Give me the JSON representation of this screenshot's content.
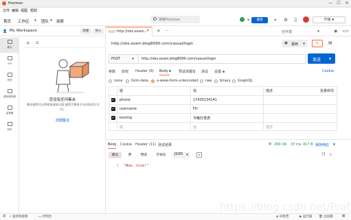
{
  "window": {
    "title": "Postman",
    "minimize": "—",
    "maximize": "☐",
    "close": "✕"
  },
  "menu": [
    "文件",
    "编辑",
    "视图",
    "帮助"
  ],
  "header": {
    "nav": [
      "首页",
      "工作区",
      "团队",
      "探索"
    ],
    "search_placeholder": "搜索Postman",
    "invite_label": "邀请",
    "upgrade_label": "升级"
  },
  "sidebar": {
    "workspace": "My Workspace",
    "new_label": "新建",
    "import_label": "导入",
    "rail": [
      {
        "label": "集合",
        "icon": "collections-icon"
      },
      {
        "label": "API",
        "icon": "api-icon"
      },
      {
        "label": "环境",
        "icon": "environments-icon"
      },
      {
        "label": "模拟服务器",
        "icon": "mock-servers-icon"
      },
      {
        "label": "监视器",
        "icon": "monitors-icon"
      },
      {
        "label": "历史",
        "icon": "history-icon"
      }
    ],
    "empty_title": "您没有任何集合",
    "empty_desc": "集合使您可以将相关请求分组,使您可更易于访问和运行它们。",
    "create_link": "创建集合"
  },
  "tabs": {
    "active_method": "POST",
    "active_url": "http://obs.exam...",
    "environment": "无环境"
  },
  "request": {
    "title": "http://obs.exam.blog8090.com/casual/login",
    "save_label": "保存",
    "method": "POST",
    "url": "http://obs.exam.blog8090.com/casual/login",
    "send_label": "发送",
    "tabs": [
      {
        "label": "参数"
      },
      {
        "label": "授权"
      },
      {
        "label": "Header (8)"
      },
      {
        "label": "Body"
      },
      {
        "label": "预请求脚本"
      },
      {
        "label": "测试"
      },
      {
        "label": "设置"
      }
    ],
    "cookies_label": "Cookie",
    "body_types": [
      "none",
      "form-data",
      "x-www-form-urlencoded",
      "raw",
      "binary",
      "GraphQL"
    ],
    "selected_body_type": "x-www-form-urlencoded",
    "table": {
      "headers": {
        "key": "键",
        "value": "值",
        "desc": "描述",
        "bulk": "批量修改"
      },
      "rows": [
        {
          "key": "phone",
          "value": "17435134141"
        },
        {
          "key": "username",
          "value": "FD"
        },
        {
          "key": "kouling",
          "value": "今晚打老虎"
        }
      ],
      "placeholder": {
        "key": "键",
        "value": "值",
        "desc": "描述"
      }
    }
  },
  "response": {
    "tabs": [
      "Body",
      "Cookie",
      "Header (11)",
      "测试结果"
    ],
    "status": "200 OK",
    "time": "37 ms",
    "size": "417 B",
    "save_label": "保存响应",
    "formats": [
      "美化",
      "原",
      "预览",
      "可视化"
    ],
    "format_select": "JSON",
    "line_number": "1",
    "body": "\"Wow, nice!\""
  },
  "statusbar": {
    "find_replace": "查找和替换",
    "console": "控制台",
    "bootcamp": "训练营",
    "runner": "运行器",
    "trash": "垃圾箱"
  },
  "watermark": "https://blog.csdn.net/Prof_ZTC"
}
